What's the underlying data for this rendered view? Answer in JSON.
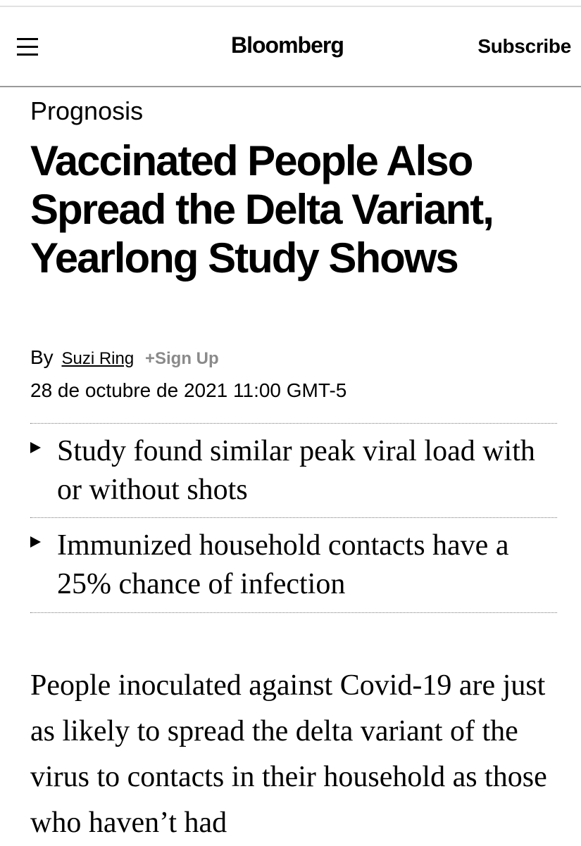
{
  "header": {
    "logo": "Bloomberg",
    "subscribe_label": "Subscribe"
  },
  "article": {
    "kicker": "Prognosis",
    "headline": "Vaccinated People Also Spread the Delta Variant, Yearlong Study Shows",
    "byline": {
      "by_label": "By",
      "author": "Suzi Ring",
      "signup_label": "+Sign Up"
    },
    "dateline": "28 de octubre de 2021 11:00 GMT-5",
    "bullets": [
      "Study found similar peak viral load with or without shots",
      "Immunized household contacts have a 25% chance of infection"
    ],
    "body": "People inoculated against Covid-19 are just as likely to spread the delta variant of the virus to contacts in their household as those who haven’t had"
  },
  "icons": {
    "menu": "hamburger-menu-icon",
    "bullet": "triangle-right-icon"
  },
  "colors": {
    "text": "#000000",
    "signup": "#8a8a8a",
    "header_rule": "#9a9a9a"
  }
}
